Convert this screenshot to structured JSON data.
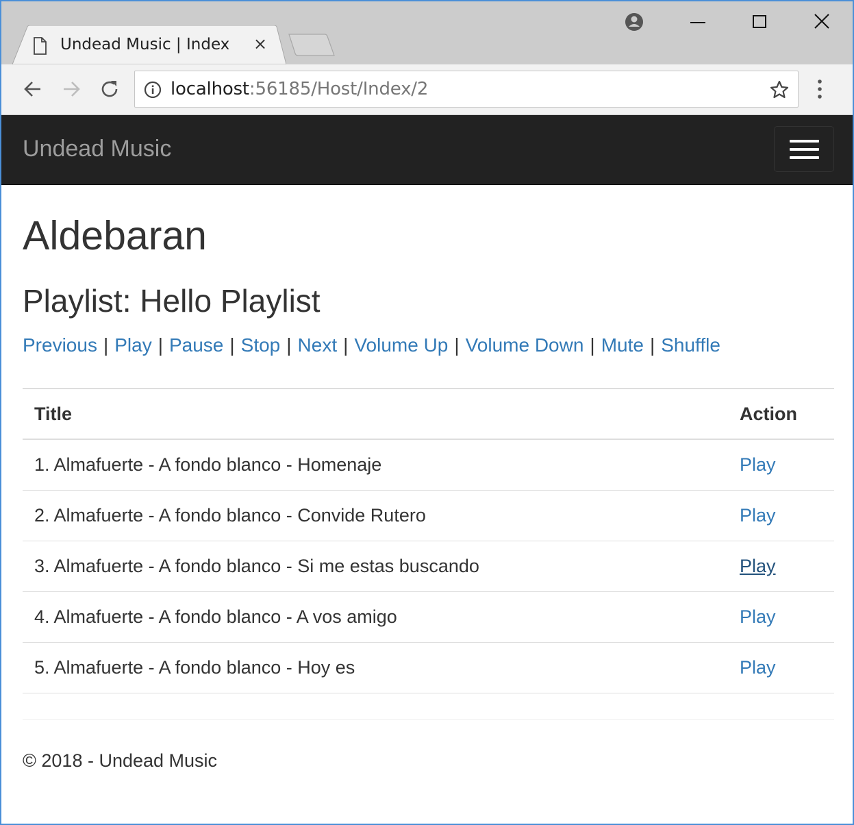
{
  "browser": {
    "tab_title": "Undead Music | Index",
    "tab_close": "×",
    "url_host": "localhost",
    "url_path": ":56185/Host/Index/2"
  },
  "site": {
    "brand": "Undead Music"
  },
  "page": {
    "heading": "Aldebaran",
    "playlist_heading": "Playlist: Hello Playlist",
    "separator": "|",
    "controls": [
      "Previous",
      "Play",
      "Pause",
      "Stop",
      "Next",
      "Volume Up",
      "Volume Down",
      "Mute",
      "Shuffle"
    ]
  },
  "table": {
    "headers": {
      "title": "Title",
      "action": "Action"
    },
    "rows": [
      {
        "title": "1. Almafuerte - A fondo blanco - Homenaje",
        "action": "Play"
      },
      {
        "title": "2. Almafuerte - A fondo blanco - Convide Rutero",
        "action": "Play"
      },
      {
        "title": "3. Almafuerte - A fondo blanco - Si me estas buscando",
        "action": "Play"
      },
      {
        "title": "4. Almafuerte - A fondo blanco - A vos amigo",
        "action": "Play"
      },
      {
        "title": "5. Almafuerte - A fondo blanco - Hoy es",
        "action": "Play"
      }
    ]
  },
  "footer": {
    "text": "© 2018 - Undead Music"
  },
  "colors": {
    "link": "#337ab7",
    "navbar": "#222222",
    "brand": "#9d9d9d",
    "window_border": "#4a8fd8"
  },
  "icons": {
    "tab": "document-icon",
    "back": "back-arrow-icon",
    "forward": "forward-arrow-icon",
    "reload": "reload-icon",
    "info": "info-icon",
    "bookmark": "star-icon",
    "menu": "vertical-dots-icon",
    "profile": "profile-icon",
    "navbar_toggle": "hamburger-icon"
  }
}
